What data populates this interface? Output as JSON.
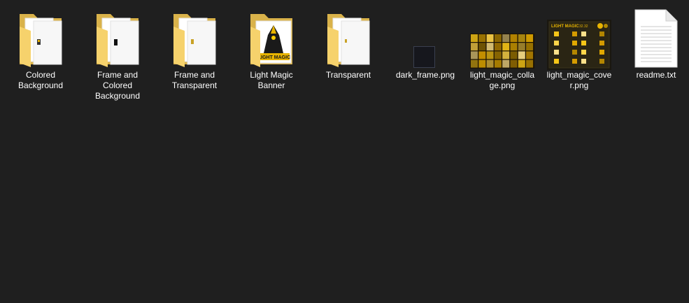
{
  "items": [
    {
      "label": "Colored\nBackground",
      "icon": "folder-icon"
    },
    {
      "label": "Frame and\nColored\nBackground",
      "icon": "folder-icon"
    },
    {
      "label": "Frame and\nTransparent",
      "icon": "folder-icon"
    },
    {
      "label": "Light Magic\nBanner",
      "icon": "folder-icon",
      "banner_text": "LIGHT MAGIC"
    },
    {
      "label": "Transparent",
      "icon": "folder-icon"
    },
    {
      "label": "dark_frame.png",
      "icon": "image-icon"
    },
    {
      "label": "light_magic_colla\nge.png",
      "icon": "image-icon"
    },
    {
      "label": "light_magic_cove\nr.png",
      "icon": "image-icon",
      "cover_title": "LIGHT MAGIC",
      "cover_badge": "32.32"
    },
    {
      "label": "readme.txt",
      "icon": "text-file-icon"
    }
  ],
  "colors": {
    "background": "#1f1f1f",
    "folder_back": "#dcb64e",
    "folder_front": "#f8d874",
    "accent_gold": "#e8b400"
  }
}
